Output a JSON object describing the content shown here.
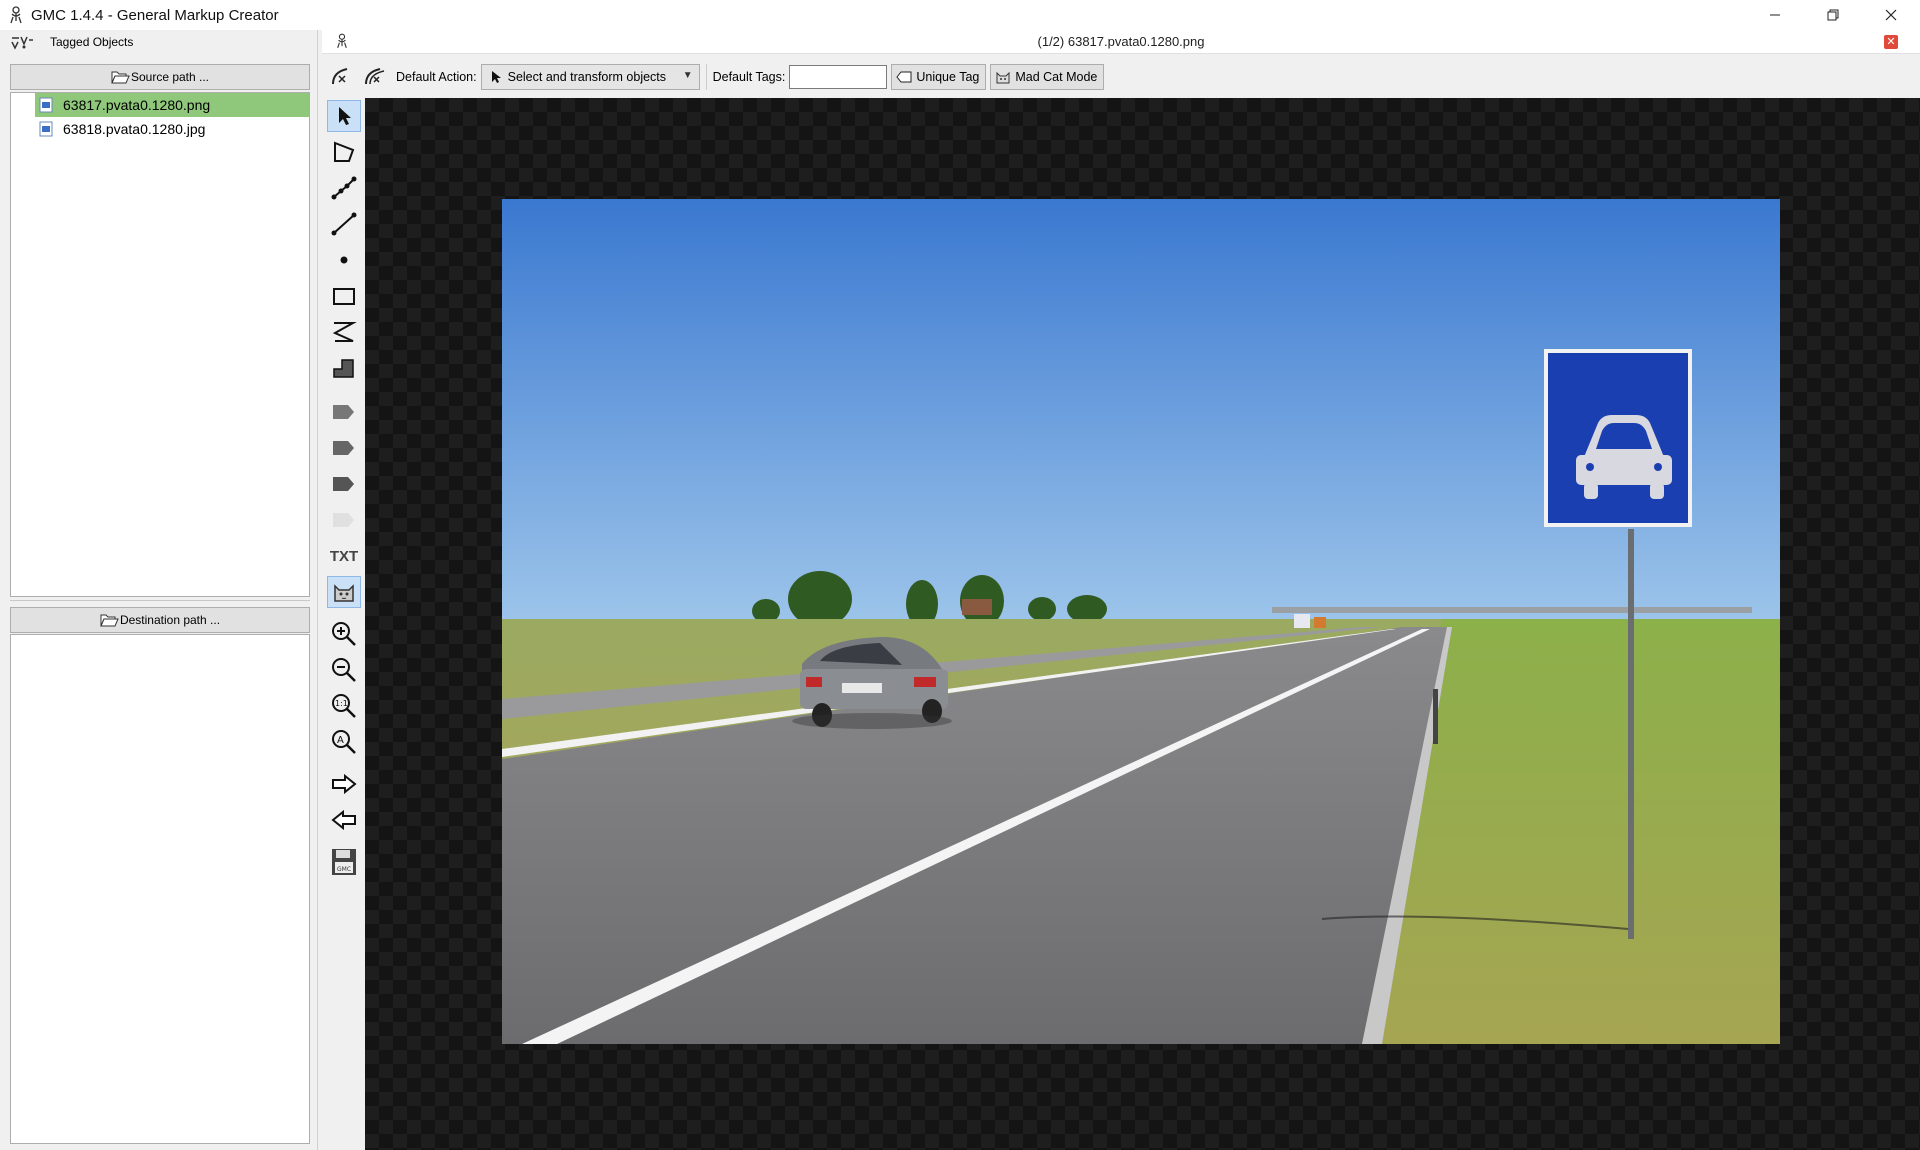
{
  "window": {
    "title": "GMC 1.4.4 - General Markup Creator"
  },
  "left_panel": {
    "tagged_objects_label": "Tagged Objects",
    "source_path_button": "Source path ...",
    "destination_path_button": "Destination path ...",
    "files": [
      {
        "name": "63817.pvata0.1280.png",
        "selected": true
      },
      {
        "name": "63818.pvata0.1280.jpg",
        "selected": false
      }
    ]
  },
  "document": {
    "title": "(1/2) 63817.pvata0.1280.png"
  },
  "toolbar": {
    "default_action_label": "Default Action:",
    "default_action_value": "Select and transform objects",
    "default_tags_label": "Default Tags:",
    "default_tags_value": "",
    "unique_tag_button": "Unique Tag",
    "mad_cat_mode_button": "Mad Cat Mode"
  },
  "tools": {
    "txt_label": "TXT",
    "active_tool": "select-tool"
  },
  "colors": {
    "selected_file_bg": "#8fc87a",
    "active_tool_bg": "#c9e0f7",
    "sign_blue": "#1a3fb0",
    "sky_blue": "#4a86d8"
  }
}
